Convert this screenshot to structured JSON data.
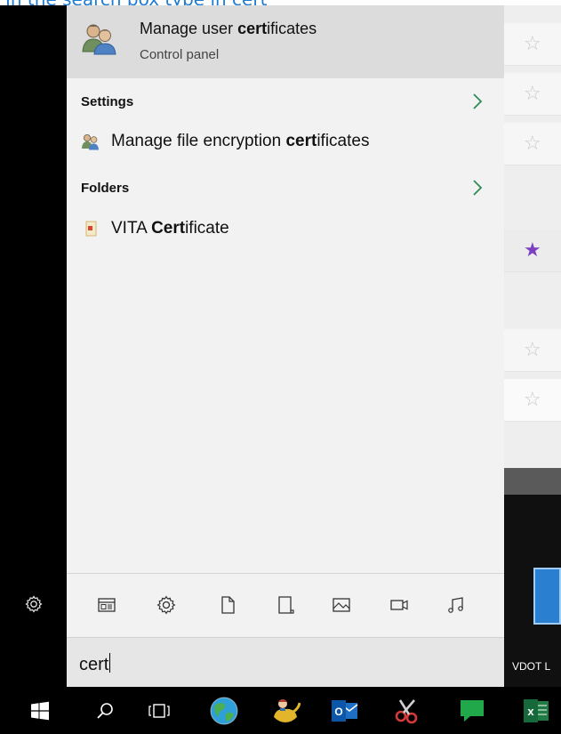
{
  "caption": "In the search box type in cert",
  "top_result": {
    "title_prefix": "Manage user ",
    "title_bold": "cert",
    "title_suffix": "ificates",
    "subtitle": "Control panel"
  },
  "sections": {
    "settings_label": "Settings",
    "settings_item_prefix": "Manage file encryption ",
    "settings_item_bold": "cert",
    "settings_item_suffix": "ificates",
    "folders_label": "Folders",
    "folders_item_prefix": "VITA ",
    "folders_item_bold": "Cert",
    "folders_item_suffix": "ificate"
  },
  "search": {
    "query": "cert"
  },
  "desktop": {
    "icon_label": "VDOT L"
  },
  "filter_icons": [
    "apps-icon",
    "settings-icon",
    "documents-icon",
    "folders-icon",
    "photos-icon",
    "videos-icon",
    "music-icon"
  ],
  "taskbar_icons": [
    "windows-start-icon",
    "search-icon",
    "task-view-icon",
    "globe-app-icon",
    "genie-app-icon",
    "outlook-icon",
    "snipping-tool-icon",
    "chat-icon",
    "excel-icon"
  ],
  "colors": {
    "caption": "#1e7bd0",
    "accent_arrow": "#2e8b57",
    "star_active": "#7d3fc2"
  }
}
